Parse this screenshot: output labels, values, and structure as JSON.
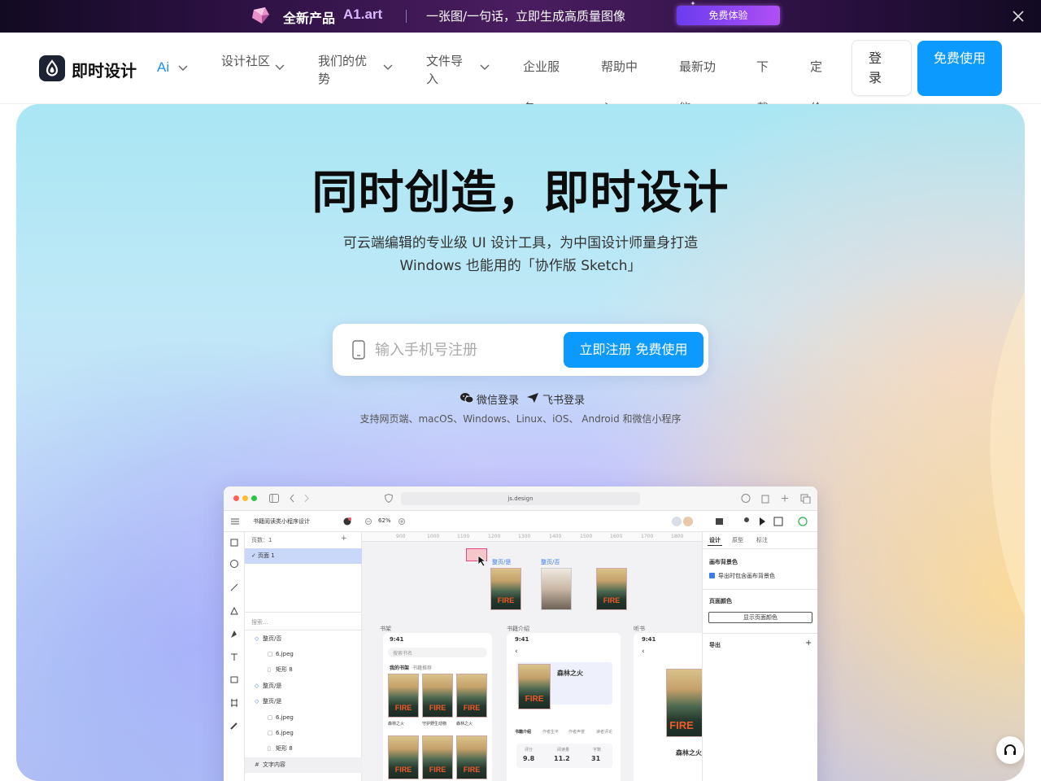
{
  "promo": {
    "title": "全新产品",
    "brand": "A1.art",
    "desc": "一张图/一句话，立即生成高质量图像",
    "button": "免费体验"
  },
  "nav": {
    "logo": "即时设计",
    "ai": "Ai",
    "items": [
      {
        "label": "设计社区"
      },
      {
        "label": "我们的优势"
      },
      {
        "label": "文件导入"
      },
      {
        "label": "企业服务"
      },
      {
        "label": "帮助中心"
      },
      {
        "label": "最新功能"
      },
      {
        "label": "下载"
      },
      {
        "label": "定价"
      }
    ],
    "login": "登录",
    "free": "免费使用"
  },
  "hero": {
    "title": "同时创造，即时设计",
    "subtitle_line1": "可云端编辑的专业级 UI 设计工具，为中国设计师量身打造",
    "subtitle_line2": "Windows 也能用的「协作版 Sketch」",
    "phone_placeholder": "输入手机号注册",
    "register_button": "立即注册 免费使用",
    "wechat_login": "微信登录",
    "feishu_login": "飞书登录",
    "platforms": "支持网页端、macOS、Windows、Linux、iOS、 Android 和微信小程序"
  },
  "mock": {
    "url": "js.design",
    "project": "书籍阅读类小程序设计",
    "zoom": "62%",
    "pages_label": "页数：1",
    "page1": "页面 1",
    "search": "搜索...",
    "layers": [
      "整页/否",
      "6.jpeg",
      "矩形 8",
      "整页/是",
      "整页/是",
      "6.jpeg",
      "6.jpeg",
      "矩形 8",
      "文字内容"
    ],
    "ruler": [
      "900",
      "1000",
      "1100",
      "1200",
      "1300",
      "1400",
      "1500",
      "1600",
      "1700",
      "1800"
    ],
    "frame_tag_1": "整页/是",
    "frame_tag_2": "整页/否",
    "frame_labels": [
      "书架",
      "书籍介绍",
      "听书"
    ],
    "time": "9:41",
    "search_book": "搜索书名",
    "my_books": "我的书架",
    "recent": "书籍推荐",
    "book_title": "森林之火",
    "book_names": [
      "森林之火",
      "守护野生动物",
      "森林之火"
    ],
    "book_tabs": [
      "书籍介绍",
      "作者生平",
      "作者声誉",
      "读者评论"
    ],
    "stats": [
      {
        "label": "评分",
        "value": "9.8"
      },
      {
        "label": "阅读量",
        "value": "11.2"
      },
      {
        "label": "字数",
        "value": "31"
      }
    ],
    "panel_tabs": [
      "设计",
      "原型",
      "标注"
    ],
    "canvas_bg": "画布背景色",
    "export_bg": "导出时包含画布背景色",
    "page_color": "页面颜色",
    "show_page_color": "显示页面颜色",
    "export": "导出"
  },
  "colors": {
    "accent": "#0d9aff",
    "brand_dark": "#1c2333"
  }
}
